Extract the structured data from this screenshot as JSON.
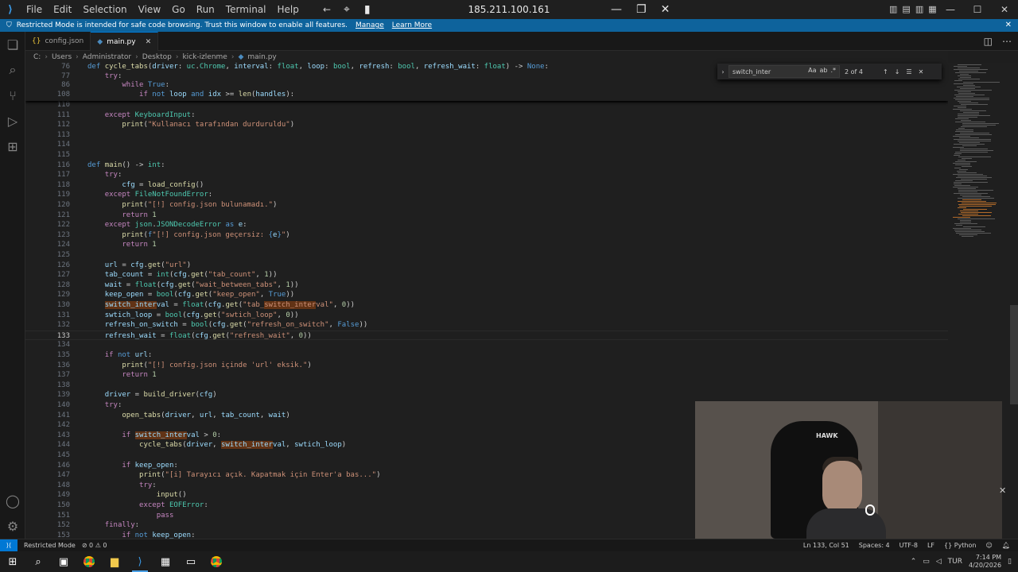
{
  "titlebar": {
    "menu": [
      "File",
      "Edit",
      "Selection",
      "View",
      "Go",
      "Run",
      "Terminal",
      "Help"
    ],
    "remote_ip": "185.211.100.161"
  },
  "banner": {
    "message": "Restricted Mode is intended for safe code browsing. Trust this window to enable all features.",
    "manage_label": "Manage",
    "learn_more_label": "Learn More"
  },
  "tabs": [
    {
      "label": "config.json",
      "active": false
    },
    {
      "label": "main.py",
      "active": true
    }
  ],
  "breadcrumb": [
    "C:",
    "Users",
    "Administrator",
    "Desktop",
    "kick-izlenme",
    "main.py"
  ],
  "find": {
    "query": "switch_inter",
    "match_count": "2 of 4",
    "options": [
      "Aa",
      "ab",
      ".*"
    ]
  },
  "editor": {
    "current_line": 133,
    "sticky_lines": [
      {
        "num": "76",
        "html": "<span class=\"d\">def</span> <span class=\"f\">cycle_tabs</span>(<span class=\"v\">driver</span>: <span class=\"t\">uc</span>.<span class=\"t\">Chrome</span>, <span class=\"v\">interval</span>: <span class=\"t\">float</span>, <span class=\"v\">loop</span>: <span class=\"t\">bool</span>, <span class=\"v\">refresh</span>: <span class=\"t\">bool</span>, <span class=\"v\">refresh_wait</span>: <span class=\"t\">float</span>) -> <span class=\"d\">None</span>:"
      },
      {
        "num": "77",
        "html": "    <span class=\"k\">try</span>:"
      },
      {
        "num": "86",
        "html": "        <span class=\"k\">while</span> <span class=\"d\">True</span>:"
      },
      {
        "num": "108",
        "html": "            <span class=\"k\">if</span> <span class=\"d\">not</span> <span class=\"v\">loop</span> <span class=\"d\">and</span> <span class=\"v\">idx</span> >= <span class=\"f\">len</span>(<span class=\"v\">handles</span>):"
      }
    ],
    "lines": [
      {
        "num": "110",
        "html": ""
      },
      {
        "num": "111",
        "html": "    <span class=\"k\">except</span> <span class=\"t\">KeyboardInput</span>:"
      },
      {
        "num": "112",
        "html": "        <span class=\"f\">print</span>(<span class=\"s\">\"Kullanacı tarafından durduruldu\"</span>)"
      },
      {
        "num": "113",
        "html": ""
      },
      {
        "num": "114",
        "html": ""
      },
      {
        "num": "115",
        "html": ""
      },
      {
        "num": "116",
        "html": "<span class=\"d\">def</span> <span class=\"f\">main</span>() -> <span class=\"t\">int</span>:"
      },
      {
        "num": "117",
        "html": "    <span class=\"k\">try</span>:"
      },
      {
        "num": "118",
        "html": "        <span class=\"v\">cfg</span> = <span class=\"f\">load_config</span>()"
      },
      {
        "num": "119",
        "html": "    <span class=\"k\">except</span> <span class=\"t\">FileNotFoundError</span>:"
      },
      {
        "num": "120",
        "html": "        <span class=\"f\">print</span>(<span class=\"s\">\"[!] config.json bulunamadı.\"</span>)"
      },
      {
        "num": "121",
        "html": "        <span class=\"k\">return</span> <span class=\"n\">1</span>"
      },
      {
        "num": "122",
        "html": "    <span class=\"k\">except</span> <span class=\"t\">json</span>.<span class=\"t\">JSONDecodeError</span> <span class=\"d\">as</span> <span class=\"v\">e</span>:"
      },
      {
        "num": "123",
        "html": "        <span class=\"f\">print</span>(<span class=\"d\">f</span><span class=\"s\">\"[!] config.json geçersiz: </span><span class=\"d\">{</span><span class=\"v\">e</span><span class=\"d\">}</span><span class=\"s\">\"</span>)"
      },
      {
        "num": "124",
        "html": "        <span class=\"k\">return</span> <span class=\"n\">1</span>"
      },
      {
        "num": "125",
        "html": ""
      },
      {
        "num": "126",
        "html": "    <span class=\"v\">url</span> = <span class=\"v\">cfg</span>.<span class=\"f\">get</span>(<span class=\"s\">\"url\"</span>)"
      },
      {
        "num": "127",
        "html": "    <span class=\"v\">tab_count</span> = <span class=\"t\">int</span>(<span class=\"v\">cfg</span>.<span class=\"f\">get</span>(<span class=\"s\">\"tab_count\"</span>, <span class=\"n\">1</span>))"
      },
      {
        "num": "128",
        "html": "    <span class=\"v\">wait</span> = <span class=\"t\">float</span>(<span class=\"v\">cfg</span>.<span class=\"f\">get</span>(<span class=\"s\">\"wait_between_tabs\"</span>, <span class=\"n\">1</span>))"
      },
      {
        "num": "129",
        "html": "    <span class=\"v\">keep_open</span> = <span class=\"t\">bool</span>(<span class=\"v\">cfg</span>.<span class=\"f\">get</span>(<span class=\"s\">\"keep_open\"</span>, <span class=\"d\">True</span>))"
      },
      {
        "num": "130",
        "html": "    <span class=\"v hl\">switch_inter</span><span class=\"v\">val</span> = <span class=\"t\">float</span>(<span class=\"v\">cfg</span>.<span class=\"f\">get</span>(<span class=\"s\">\"tab_</span><span class=\"s hl\">switch_inter</span><span class=\"s\">val\"</span>, <span class=\"n\">0</span>))"
      },
      {
        "num": "131",
        "html": "    <span class=\"v\">swtich_loop</span> = <span class=\"t\">bool</span>(<span class=\"v\">cfg</span>.<span class=\"f\">get</span>(<span class=\"s\">\"swtich_loop\"</span>, <span class=\"n\">0</span>))"
      },
      {
        "num": "132",
        "html": "    <span class=\"v\">refresh_on_switch</span> = <span class=\"t\">bool</span>(<span class=\"v\">cfg</span>.<span class=\"f\">get</span>(<span class=\"s\">\"refresh_on_switch\"</span>, <span class=\"d\">False</span>))"
      },
      {
        "num": "133",
        "html": "    <span class=\"v\">refresh_wait</span> = <span class=\"t\">float</span>(<span class=\"v\">cfg</span>.<span class=\"f\">get</span>(<span class=\"s\">\"refresh_wait\"</span>, <span class=\"n\">0</span>))"
      },
      {
        "num": "134",
        "html": ""
      },
      {
        "num": "135",
        "html": "    <span class=\"k\">if</span> <span class=\"d\">not</span> <span class=\"v\">url</span>:"
      },
      {
        "num": "136",
        "html": "        <span class=\"f\">print</span>(<span class=\"s\">\"[!] config.json içinde 'url' eksik.\"</span>)"
      },
      {
        "num": "137",
        "html": "        <span class=\"k\">return</span> <span class=\"n\">1</span>"
      },
      {
        "num": "138",
        "html": ""
      },
      {
        "num": "139",
        "html": "    <span class=\"v\">driver</span> = <span class=\"f\">build_driver</span>(<span class=\"v\">cfg</span>)"
      },
      {
        "num": "140",
        "html": "    <span class=\"k\">try</span>:"
      },
      {
        "num": "141",
        "html": "        <span class=\"f\">open_tabs</span>(<span class=\"v\">driver</span>, <span class=\"v\">url</span>, <span class=\"v\">tab_count</span>, <span class=\"v\">wait</span>)"
      },
      {
        "num": "142",
        "html": ""
      },
      {
        "num": "143",
        "html": "        <span class=\"k\">if</span> <span class=\"v hl\">switch_inter</span><span class=\"v\">val</span> > <span class=\"n\">0</span>:"
      },
      {
        "num": "144",
        "html": "            <span class=\"f\">cycle_tabs</span>(<span class=\"v\">driver</span>, <span class=\"v hl\">switch_inter</span><span class=\"v\">val</span>, <span class=\"v\">swtich_loop</span>)"
      },
      {
        "num": "145",
        "html": ""
      },
      {
        "num": "146",
        "html": "        <span class=\"k\">if</span> <span class=\"v\">keep_open</span>:"
      },
      {
        "num": "147",
        "html": "            <span class=\"f\">print</span>(<span class=\"s\">\"[i] Tarayıcı açık. Kapatmak için Enter'a bas...\"</span>)"
      },
      {
        "num": "148",
        "html": "            <span class=\"k\">try</span>:"
      },
      {
        "num": "149",
        "html": "                <span class=\"f\">input</span>()"
      },
      {
        "num": "150",
        "html": "            <span class=\"k\">except</span> <span class=\"t\">EOFError</span>:"
      },
      {
        "num": "151",
        "html": "                <span class=\"k\">pass</span>"
      },
      {
        "num": "152",
        "html": "    <span class=\"k\">finally</span>:"
      },
      {
        "num": "153",
        "html": "        <span class=\"k\">if</span> <span class=\"d\">not</span> <span class=\"v\">keep_open</span>:"
      }
    ]
  },
  "webcam": {
    "chair_logo": "HAWK"
  },
  "statusbar": {
    "restricted": "Restricted Mode",
    "problems": "⊘ 0 ⚠ 0",
    "cursor": "Ln 133, Col 51",
    "spaces": "Spaces: 4",
    "encoding": "UTF-8",
    "eol": "LF",
    "language": "Python"
  },
  "taskbar": {
    "lang": "TUR",
    "time": "7:14 PM",
    "date": "4/20/2026"
  },
  "colors": {
    "accent": "#0078d4",
    "banner": "#0e639c",
    "find_highlight": "#623315"
  }
}
